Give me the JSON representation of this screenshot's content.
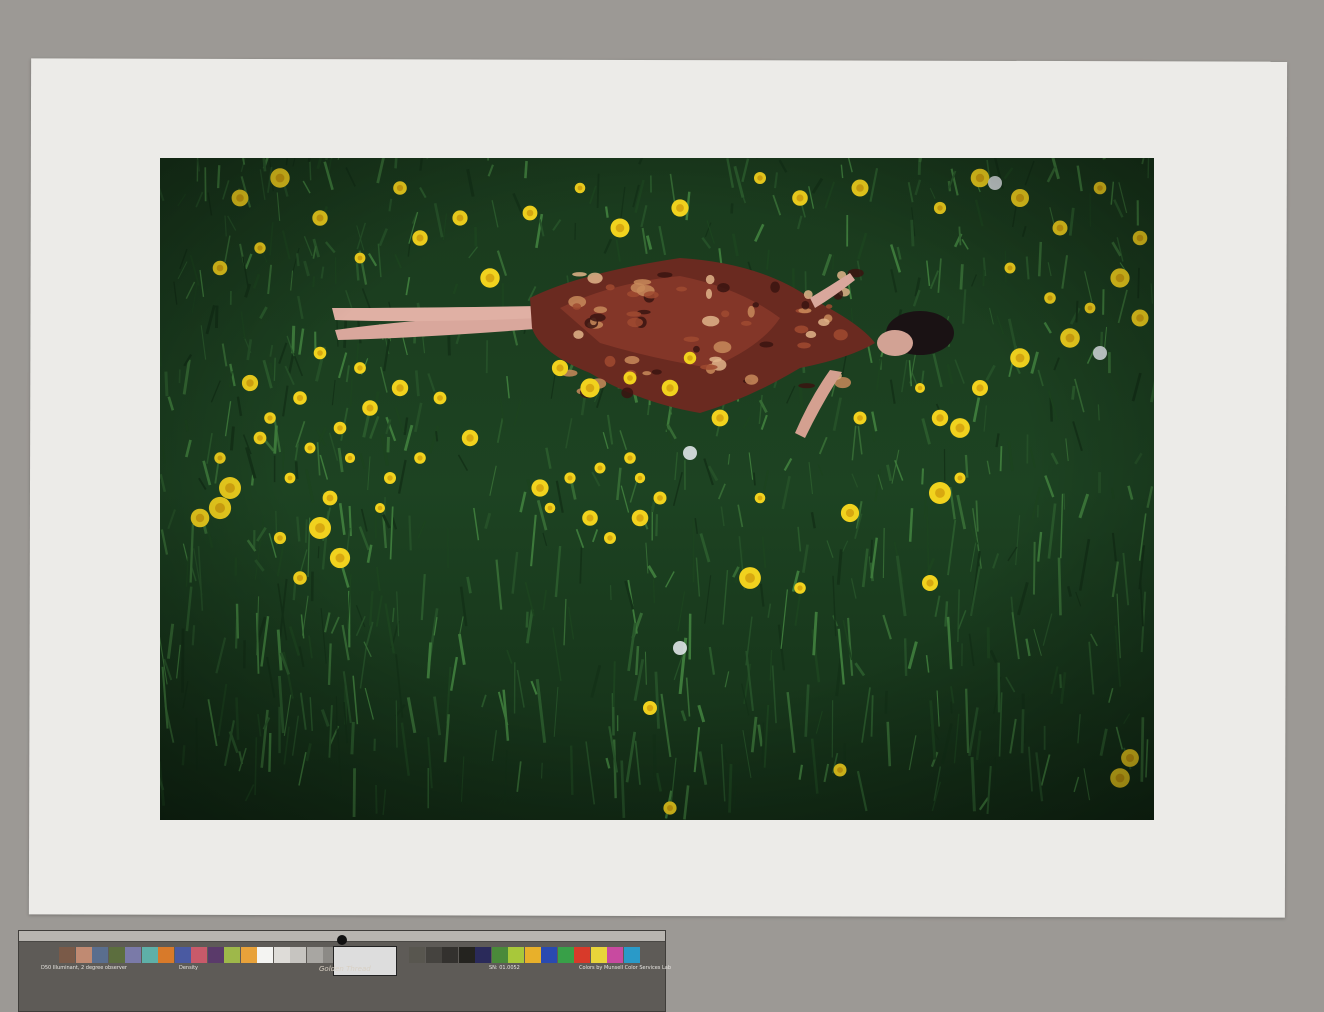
{
  "scene": {
    "description_free": true,
    "subject_palette": {
      "grass_dark": "#0f2413",
      "grass_mid": "#1f4a22",
      "grass_light": "#3f7a3a",
      "dandelion": "#f2d21c",
      "dress": "#7a2e22",
      "skin": "#d8a79a"
    }
  },
  "color_target": {
    "swatches_left": [
      "#7a5a48",
      "#c08a72",
      "#5a6e8e",
      "#5c6e3e",
      "#7a7aa8",
      "#5eb0a8",
      "#d87a2a",
      "#4a5aa2",
      "#c85a6a",
      "#5a3a6a",
      "#9eb84a",
      "#e8a23a",
      "#f4f4f2",
      "#dedcd8",
      "#c6c4c0",
      "#a8a6a2",
      "#8c8a86",
      "#6e6c68"
    ],
    "swatches_right": [
      "#58564f",
      "#45433f",
      "#33312e",
      "#24231f",
      "#2a2a5a",
      "#4a8a3a",
      "#a8c83a",
      "#e8b02a",
      "#2a4ab0",
      "#38a048",
      "#d83a2a",
      "#e8d43a",
      "#c84aa0",
      "#2a9ac8"
    ],
    "label_left": "D50 Illuminant, 2 degree observer",
    "label_density": "Density",
    "label_serial": "SN: 01.0052",
    "label_brand": "Golden Thread",
    "label_right": "Colors by Munsell Color Services Lab"
  }
}
